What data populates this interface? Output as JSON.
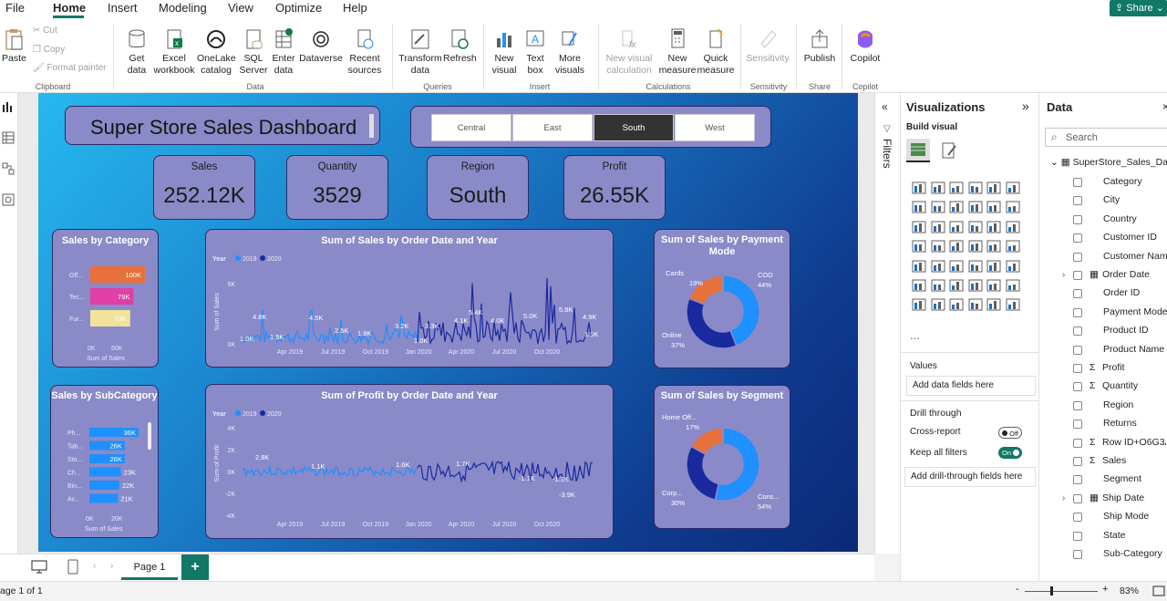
{
  "menu": {
    "file": "File",
    "home": "Home",
    "insert": "Insert",
    "modeling": "Modeling",
    "view": "View",
    "optimize": "Optimize",
    "help": "Help",
    "share": "Share"
  },
  "ribbon": {
    "paste": "Paste",
    "cut": "Cut",
    "copy": "Copy",
    "format_painter": "Format painter",
    "clipboard": "Clipboard",
    "get_data": "Get data",
    "excel": "Excel workbook",
    "onelake": "OneLake catalog",
    "sql": "SQL Server",
    "enter_data": "Enter data",
    "dataverse": "Dataverse",
    "recent": "Recent sources",
    "data": "Data",
    "transform": "Transform data",
    "refresh": "Refresh",
    "queries": "Queries",
    "new_visual": "New visual",
    "text_box": "Text box",
    "more_visuals": "More visuals",
    "insert": "Insert",
    "new_visual_calc": "New visual calculation",
    "new_measure": "New measure",
    "quick_measure": "Quick measure",
    "calculations": "Calculations",
    "sensitivity": "Sensitivity",
    "sensitivity_group": "Sensitivity",
    "publish": "Publish",
    "share_group": "Share",
    "copilot": "Copilot",
    "copilot_group": "Copilot"
  },
  "dashboard": {
    "title": "Super Store Sales Dashboard",
    "regions": [
      "Central",
      "East",
      "South",
      "West"
    ],
    "selected_region": "South",
    "kpis": [
      {
        "label": "Sales",
        "value": "252.12K"
      },
      {
        "label": "Quantity",
        "value": "3529"
      },
      {
        "label": "Region",
        "value": "South"
      },
      {
        "label": "Profit",
        "value": "26.55K"
      }
    ],
    "sales_by_category": {
      "title": "Sales by Category",
      "xlabel": "Sum of Sales",
      "ticks": [
        "0K",
        "50K"
      ],
      "items": [
        {
          "label": "Off...",
          "value": "100K",
          "color": "#e8703a",
          "frac": 1.0
        },
        {
          "label": "Tec...",
          "value": "79K",
          "color": "#e03fa5",
          "frac": 0.79
        },
        {
          "label": "Fur...",
          "value": "73K",
          "color": "#f2e39a",
          "frac": 0.73
        }
      ]
    },
    "sales_by_subcategory": {
      "title": "Sales by SubCategory",
      "xlabel": "Sum of Sales",
      "ticks": [
        "0K",
        "20K"
      ],
      "items": [
        {
          "label": "Ph...",
          "value": "36K",
          "frac": 1.0
        },
        {
          "label": "Tab...",
          "value": "26K",
          "frac": 0.72
        },
        {
          "label": "Sto...",
          "value": "26K",
          "frac": 0.72
        },
        {
          "label": "Ch...",
          "value": "23K",
          "frac": 0.64
        },
        {
          "label": "Bin...",
          "value": "22K",
          "frac": 0.61
        },
        {
          "label": "Ac...",
          "value": "21K",
          "frac": 0.58
        }
      ]
    },
    "sales_line": {
      "title": "Sum of Sales by Order Date and Year",
      "legend_title": "Year",
      "legend": [
        "2019",
        "2020"
      ],
      "ylabel": "Sum of Sales",
      "yticks": [
        "5K",
        "0K"
      ],
      "xticks": [
        "Apr 2019",
        "Jul 2019",
        "Oct 2019",
        "Jan 2020",
        "Apr 2020",
        "Jul 2020",
        "Oct 2020"
      ],
      "labels": [
        "4.8K",
        "1.0K",
        "1.5K",
        "4.5K",
        "2.5K",
        "1.9K",
        "3.2K",
        "1.0K",
        "3.3K",
        "4.1K",
        "5.4K",
        "4.0K",
        "5.0K",
        "5.8K",
        "4.9K",
        "1.9K"
      ]
    },
    "profit_line": {
      "title": "Sum of Profit by Order Date and Year",
      "legend_title": "Year",
      "legend": [
        "2019",
        "2020"
      ],
      "ylabel": "Sum of Profit",
      "yticks": [
        "4K",
        "2K",
        "0K",
        "-2K",
        "-4K"
      ],
      "xticks": [
        "Apr 2019",
        "Jul 2019",
        "Oct 2019",
        "Jan 2020",
        "Apr 2020",
        "Jul 2020",
        "Oct 2020"
      ],
      "labels": [
        "2.8K",
        "1.1K",
        "1.6K",
        "1.7K",
        "-1.1K",
        "-1.3K",
        "-3.9K"
      ]
    },
    "payment_donut": {
      "title": "Sum of Sales by Payment Mode",
      "slices": [
        {
          "label": "COD",
          "pct": "44%",
          "value": 44,
          "color": "#1e90ff"
        },
        {
          "label": "Online",
          "pct": "37%",
          "value": 37,
          "color": "#1a2a9e"
        },
        {
          "label": "Cards",
          "pct": "19%",
          "value": 19,
          "color": "#e8703a"
        }
      ]
    },
    "segment_donut": {
      "title": "Sum of Sales by Segment",
      "slices": [
        {
          "label": "Cons...",
          "pct": "54%",
          "value": 54,
          "color": "#1e90ff"
        },
        {
          "label": "Corp...",
          "pct": "30%",
          "value": 30,
          "color": "#1a2a9e"
        },
        {
          "label": "Home Off...",
          "pct": "17%",
          "value": 17,
          "color": "#e8703a"
        }
      ]
    }
  },
  "filters_label": "Filters",
  "viz_pane": {
    "title": "Visualizations",
    "build": "Build visual",
    "values": "Values",
    "add_fields": "Add data fields here",
    "drill": "Drill through",
    "cross_report": "Cross-report",
    "cross_state": "Off",
    "keep_filters": "Keep all filters",
    "keep_state": "On",
    "add_drill": "Add drill-through fields here",
    "more": "..."
  },
  "data_pane": {
    "title": "Data",
    "search_placeholder": "Search",
    "table": "SuperStore_Sales_Dat...",
    "fields": [
      {
        "name": "Category",
        "sigma": false,
        "expand": false
      },
      {
        "name": "City",
        "sigma": false,
        "expand": false
      },
      {
        "name": "Country",
        "sigma": false,
        "expand": false
      },
      {
        "name": "Customer ID",
        "sigma": false,
        "expand": false
      },
      {
        "name": "Customer Name",
        "sigma": false,
        "expand": false
      },
      {
        "name": "Order Date",
        "sigma": false,
        "expand": true
      },
      {
        "name": "Order ID",
        "sigma": false,
        "expand": false
      },
      {
        "name": "Payment Mode",
        "sigma": false,
        "expand": false
      },
      {
        "name": "Product ID",
        "sigma": false,
        "expand": false
      },
      {
        "name": "Product Name",
        "sigma": false,
        "expand": false
      },
      {
        "name": "Profit",
        "sigma": true,
        "expand": false
      },
      {
        "name": "Quantity",
        "sigma": true,
        "expand": false
      },
      {
        "name": "Region",
        "sigma": false,
        "expand": false
      },
      {
        "name": "Returns",
        "sigma": false,
        "expand": false
      },
      {
        "name": "Row ID+O6G3A1:R6",
        "sigma": true,
        "expand": false
      },
      {
        "name": "Sales",
        "sigma": true,
        "expand": false
      },
      {
        "name": "Segment",
        "sigma": false,
        "expand": false
      },
      {
        "name": "Ship Date",
        "sigma": false,
        "expand": true
      },
      {
        "name": "Ship Mode",
        "sigma": false,
        "expand": false
      },
      {
        "name": "State",
        "sigma": false,
        "expand": false
      },
      {
        "name": "Sub-Category",
        "sigma": false,
        "expand": false
      }
    ]
  },
  "tabs": {
    "page": "Page 1",
    "add": "+"
  },
  "status": {
    "page_info": "age 1 of 1",
    "zoom": "83%",
    "minus": "-",
    "plus": "+"
  },
  "colors": {
    "accent": "#117865",
    "y2019": "#1e90ff",
    "y2020": "#1a2a9e"
  }
}
